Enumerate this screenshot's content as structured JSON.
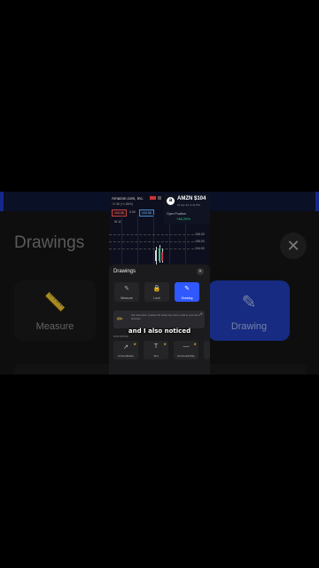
{
  "background": {
    "title": "Drawings",
    "close_glyph": "✕",
    "cards": [
      {
        "label": "Measure",
        "icon": "ruler-icon"
      },
      {
        "label": "Drawing",
        "icon": "pencil-lock-icon"
      }
    ]
  },
  "stock": {
    "name": "Amazon.com, Inc.",
    "change": "+2.36 (+1.86%)",
    "sell_price": "104.36",
    "mid": "0.00",
    "buy_price": "104.36",
    "ticker": "AMZN $104",
    "subtitle": "21 Apr 23, 9:41 PM",
    "open_position_label": "Open Position",
    "open_position_value": "+46.29%",
    "indicator": "W 1D",
    "prices": [
      "106.00",
      "105.00",
      "104.00"
    ]
  },
  "sheet": {
    "title": "Drawings",
    "close_glyph": "✕",
    "tools": [
      {
        "label": "Measure",
        "glyph": "✎"
      },
      {
        "label": "Lock",
        "glyph": "🔒"
      },
      {
        "label": "Drawing",
        "glyph": "✎"
      }
    ],
    "tip_text": "Tap 'Favorites' (marked ★) below the tools to add to your list of favorites",
    "tip_close": "✕",
    "favorites_label": "FAVORITES",
    "favorites": [
      {
        "label": "Arrow Marker",
        "glyph": "↗"
      },
      {
        "label": "Text",
        "glyph": "T"
      },
      {
        "label": "Horizontal Ray",
        "glyph": "—"
      }
    ]
  },
  "caption": "and I also noticed",
  "colors": {
    "accent": "#2f58ff",
    "up": "#33cc88",
    "down": "#cc3344"
  }
}
